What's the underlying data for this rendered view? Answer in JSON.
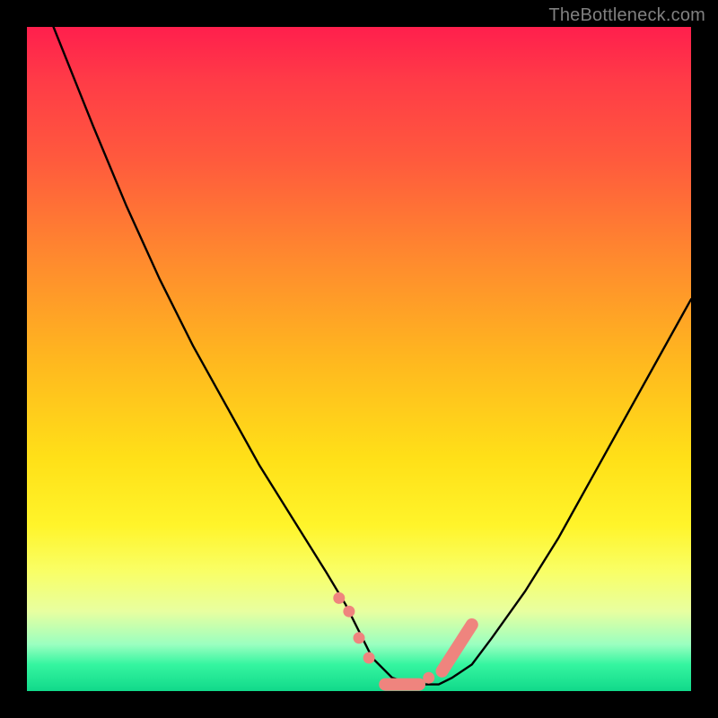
{
  "watermark": "TheBottleneck.com",
  "chart_data": {
    "type": "line",
    "title": "",
    "xlabel": "",
    "ylabel": "",
    "xlim": [
      0,
      100
    ],
    "ylim": [
      0,
      100
    ],
    "grid": false,
    "series": [
      {
        "name": "bottleneck-curve",
        "x": [
          4,
          10,
          15,
          20,
          25,
          30,
          35,
          40,
          45,
          48,
          50,
          52,
          55,
          58,
          60,
          62,
          64,
          67,
          70,
          75,
          80,
          85,
          90,
          95,
          100
        ],
        "y": [
          100,
          85,
          73,
          62,
          52,
          43,
          34,
          26,
          18,
          13,
          9,
          5,
          2,
          1,
          1,
          1,
          2,
          4,
          8,
          15,
          23,
          32,
          41,
          50,
          59
        ],
        "stroke": "#000000",
        "stroke_width": 2.4
      }
    ],
    "markers": [
      {
        "name": "pink-dots-left",
        "shape": "circle-row",
        "color": "#ef847e",
        "points": [
          {
            "x": 47,
            "y": 14
          },
          {
            "x": 48.5,
            "y": 12
          },
          {
            "x": 50,
            "y": 8
          },
          {
            "x": 51.5,
            "y": 5
          },
          {
            "x": 60.5,
            "y": 2
          }
        ]
      },
      {
        "name": "pink-pill-bottom",
        "shape": "rounded-bar",
        "color": "#ef847e",
        "x1": 53,
        "x2": 60,
        "y": 1
      },
      {
        "name": "pink-pill-right",
        "shape": "rounded-bar-diag",
        "color": "#ef847e",
        "x1": 62.5,
        "y1": 3,
        "x2": 67,
        "y2": 10
      }
    ],
    "background_gradient": {
      "stops": [
        {
          "pos": 0.0,
          "color": "#ff1f4d"
        },
        {
          "pos": 0.2,
          "color": "#ff5a3d"
        },
        {
          "pos": 0.5,
          "color": "#ffb71f"
        },
        {
          "pos": 0.75,
          "color": "#fff42a"
        },
        {
          "pos": 0.93,
          "color": "#9affc0"
        },
        {
          "pos": 1.0,
          "color": "#11d98a"
        }
      ]
    }
  }
}
